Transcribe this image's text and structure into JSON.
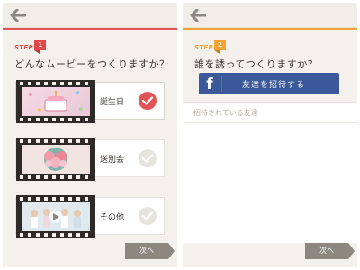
{
  "left_screen": {
    "step": {
      "label": "STEP",
      "number": "1",
      "color": "#e2474a"
    },
    "question": "どんなムービーをつくりますか？",
    "options": [
      {
        "label": "誕生日",
        "selected": true,
        "thumbnail": "birthday-cake"
      },
      {
        "label": "送別会",
        "selected": false,
        "thumbnail": "flower-bouquet"
      },
      {
        "label": "その他",
        "selected": false,
        "thumbnail": "group-photo"
      }
    ],
    "next_label": "次へ",
    "icons": {
      "back": "back-arrow-icon",
      "check": "check-icon"
    }
  },
  "right_screen": {
    "step": {
      "label": "STEP",
      "number": "2",
      "color": "#f0a233"
    },
    "question": "誰を誘ってつくりますか？",
    "facebook_button": "友達を招待する",
    "facebook_logo": "f",
    "invited_header": "招待されている友達",
    "next_label": "次へ",
    "colors": {
      "facebook": "#3b5998"
    }
  },
  "colors": {
    "accent_red": "#e25355",
    "step_orange": "#f0a233",
    "button_gray": "#8d8780"
  }
}
